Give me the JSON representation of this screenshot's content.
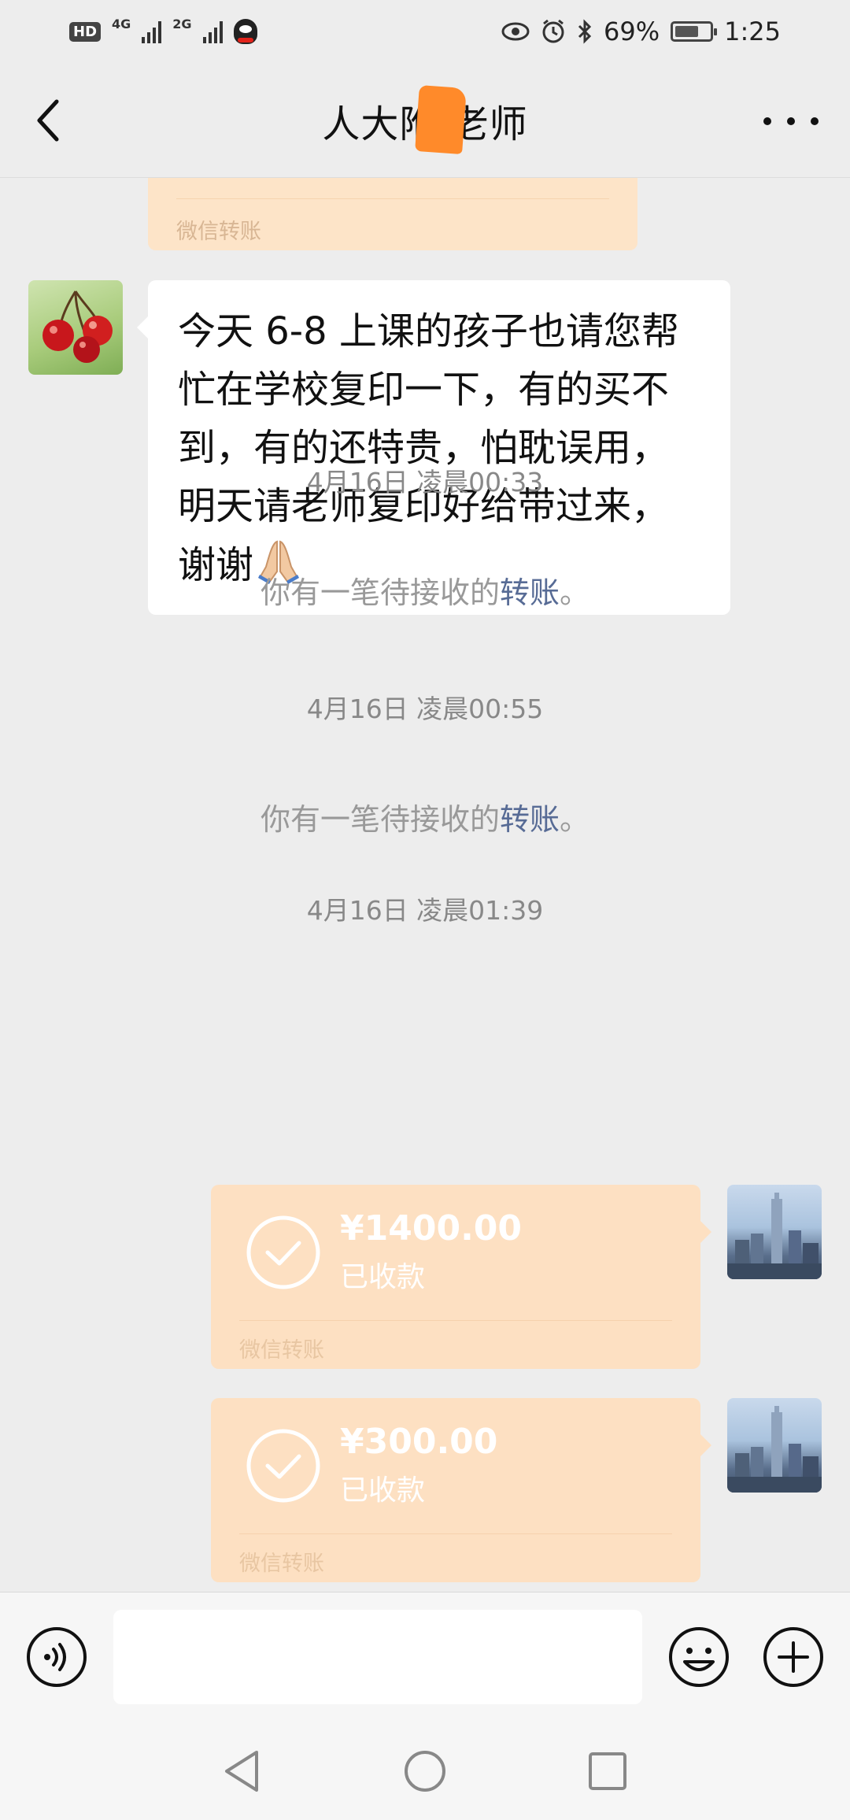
{
  "status_bar": {
    "hd": "HD",
    "net1": "4G",
    "net2": "2G",
    "battery_pct": "69%",
    "battery_level": 0.69,
    "time": "1:25",
    "icons": [
      "eye-icon",
      "alarm-icon",
      "bluetooth-icon",
      "battery-icon",
      "qq-icon"
    ]
  },
  "header": {
    "title": "人大附  老师",
    "back_icon": "chevron-left-icon",
    "more_icon": "more-dots-icon"
  },
  "messages": {
    "top_card_source": "微信转账",
    "incoming_text": "今天 6-8 上课的孩子也请您帮忙在学校复印一下，有的买不到，有的还特贵，怕耽误用，明天请老师复印好给带过来，谢谢",
    "incoming_emoji": "folded-hands-emoji",
    "ts1": "4月16日 凌晨00:33",
    "sys1_prefix": "你有一笔待接收的",
    "sys1_link": "转账",
    "sys1_suffix": "。",
    "ts2": "4月16日 凌晨00:55",
    "sys2_prefix": "你有一笔待接收的",
    "sys2_link": "转账",
    "sys2_suffix": "。",
    "ts3": "4月16日 凌晨01:39",
    "transfers": [
      {
        "amount": "¥1400.00",
        "status": "已收款",
        "source": "微信转账"
      },
      {
        "amount": "¥300.00",
        "status": "已收款",
        "source": "微信转账"
      }
    ]
  },
  "input_bar": {
    "value": "",
    "voice_icon": "voice-icon",
    "emoji_icon": "emoji-icon",
    "plus_icon": "plus-icon"
  },
  "colors": {
    "background": "#ededed",
    "transfer_card": "#fde0c2",
    "link": "#576b95",
    "redaction": "#ff8a2a"
  }
}
